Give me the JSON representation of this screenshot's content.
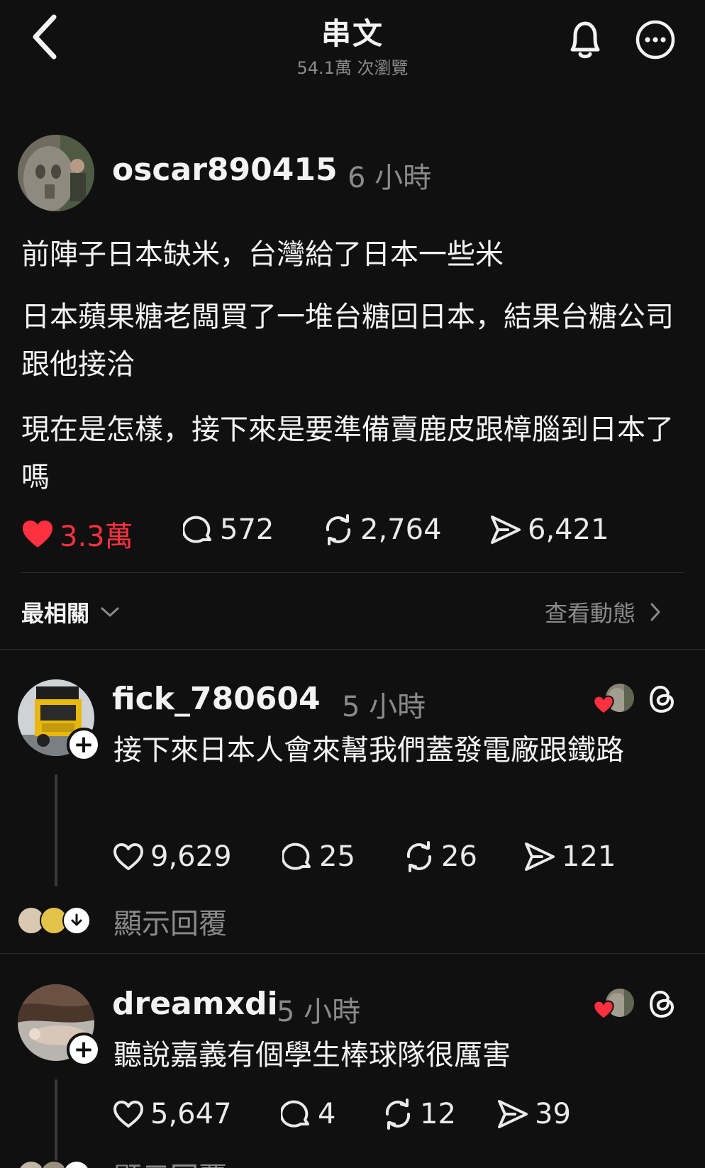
{
  "header": {
    "title": "串文",
    "views": "54.1萬 次瀏覽"
  },
  "post": {
    "username": "oscar890415",
    "time": "6 小時",
    "paragraphs": [
      "前陣子日本缺米，台灣給了日本一些米",
      "日本蘋果糖老闆買了一堆台糖回日本，結果台糖公司跟他接洽",
      "現在是怎樣，接下來是要準備賣鹿皮跟樟腦到日本了嗎"
    ],
    "likes": "3.3萬",
    "replies": "572",
    "reposts": "2,764",
    "shares": "6,421"
  },
  "sort": {
    "label": "最相關",
    "activity_link": "查看動態"
  },
  "comments": [
    {
      "username": "fick_780604",
      "time": "5 小時",
      "text": "接下來日本人會來幫我們蓋發電廠跟鐵路",
      "likes": "9,629",
      "replies": "25",
      "reposts": "26",
      "shares": "121",
      "show_replies": "顯示回覆"
    },
    {
      "username": "dreamxdi",
      "time": "5 小時",
      "text": "聽說嘉義有個學生棒球隊很厲害",
      "likes": "5,647",
      "replies": "4",
      "reposts": "12",
      "shares": "39",
      "show_replies": "顯示回覆"
    }
  ],
  "colors": {
    "background": "#101010",
    "like_red": "#ff3040",
    "muted": "#8a8a8a"
  },
  "icons": [
    "back-chevron-icon",
    "bell-icon",
    "more-icon",
    "heart-icon",
    "comment-icon",
    "repost-icon",
    "share-icon",
    "chevron-down-icon",
    "chevron-right-icon",
    "threads-icon",
    "plus-icon",
    "down-arrow-icon"
  ]
}
